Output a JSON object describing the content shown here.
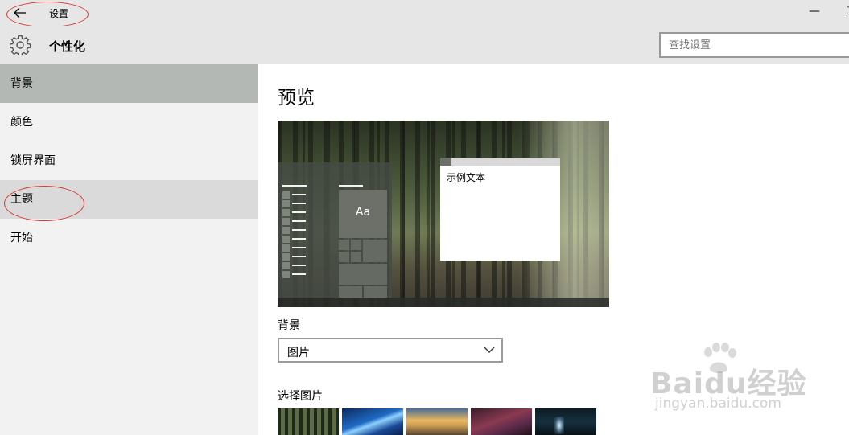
{
  "titlebar": {
    "back_icon": "back-arrow-icon",
    "title": "设置",
    "minimize_glyph": "—",
    "maximize_glyph": "☐"
  },
  "header": {
    "icon": "gear-icon",
    "title": "个性化",
    "search_placeholder": "查找设置"
  },
  "sidebar": {
    "items": [
      {
        "label": "背景",
        "state": "selected"
      },
      {
        "label": "颜色",
        "state": "normal"
      },
      {
        "label": "锁屏界面",
        "state": "normal"
      },
      {
        "label": "主题",
        "state": "hover"
      },
      {
        "label": "开始",
        "state": "normal"
      }
    ]
  },
  "main": {
    "preview_heading": "预览",
    "preview": {
      "tile_text": "Aa",
      "window_text": "示例文本"
    },
    "background_label": "背景",
    "background_select_value": "图片",
    "choose_picture_label": "选择图片",
    "thumbnails": [
      "forest",
      "windows-blue",
      "sunset-dunes",
      "night-sky",
      "glowing-figure"
    ]
  },
  "annotations": {
    "color": "#d83a3a"
  },
  "watermark": {
    "logo_text": "Baidu经验",
    "url_text": "jingyan.baidu.com"
  },
  "colors": {
    "chrome_bg": "#e6e6e6",
    "sidebar_bg": "#f2f2f2",
    "selected_bg": "#b4b8b4",
    "hover_bg": "#dadada"
  }
}
